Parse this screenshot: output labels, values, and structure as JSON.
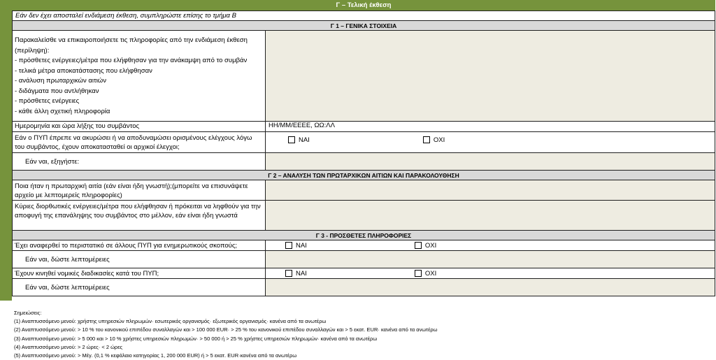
{
  "title": "Γ – Τελική έκθεση",
  "note_top": "Εάν δεν έχει αποσταλεί ενδιάμεση έκθεση, συμπληρώστε επίσης το τμήμα Β",
  "sections": {
    "g1": "Γ 1 – ΓΕΝΙΚΑ ΣΤΟΙΧΕΙΑ",
    "g2": "Γ 2 – ΑΝΑΛΥΣΗ ΤΩΝ ΠΡΩΤΑΡΧΙΚΩΝ ΑΙΤΙΩΝ ΚΑΙ ΠΑΡΑΚΟΛΟΥΘΗΣΗ",
    "g3": "Γ 3 - ΠΡΟΣΘΕΤΕΣ ΠΛΗΡΟΦΟΡΙΕΣ"
  },
  "g1": {
    "update_intro": "Παρακαλείσθε να επικαιροποιήσετε τις πληροφορίες από την ενδιάμεση έκθεση (περίληψη):",
    "update_items": [
      "- πρόσθετες ενέργειες/μέτρα που ελήφθησαν για την ανάκαμψη από το συμβάν",
      "- τελικά μέτρα αποκατάστασης που ελήφθησαν",
      "- ανάλυση πρωταρχικών αιτιών",
      "- διδάγματα που αντλήθηκαν",
      "- πρόσθετες ενέργειες",
      "- κάθε άλλη σχετική πληροφορία"
    ],
    "end_date_label": "Ημερομηνία και ώρα λήξης του συμβάντος",
    "end_date_value": "ΗΗ/ΜΜ/ΕΕΕΕ, ΩΩ:ΛΛ",
    "controls_label": "Εάν ο ΠΥΠ έπρεπε να ακυρώσει ή να αποδυναμώσει ορισμένους ελέγχους λόγω του συμβάντος, έχουν αποκατασταθεί οι αρχικοί έλεγχοι;",
    "yes": "ΝΑΙ",
    "no": "ΟΧΙ",
    "explain_label": "Εάν ναι, εξηγήστε:"
  },
  "g2": {
    "root_cause_label": "Ποια ήταν η πρωταρχική αιτία (εάν είναι ήδη γνωστή);(μπορείτε να επισυνάψετε αρχείο με λεπτομερείς πληροφορίες)",
    "corrective_label": "Κύριες διορθωτικές ενέργειες/μέτρα που ελήφθησαν ή πρόκειται να ληφθούν για την αποφυγή της επανάληψης του συμβάντος στο μέλλον, εάν είναι ήδη γνωστά"
  },
  "g3": {
    "reported_label": "Έχει αναφερθεί το περιστατικό σε άλλους ΠΥΠ για ενημερωτικούς σκοπούς;",
    "details_label": "Εάν ναι, δώστε λεπτομέρειες",
    "legal_label": "Έχουν κινηθεί νομικές διαδικασίες κατά του ΠΥΠ;",
    "details_label_2": "Εάν ναι, δώστε λεπτομέρειες",
    "yes": "ΝΑΙ",
    "no": "ΟΧΙ"
  },
  "footnotes": {
    "heading": "Σημειώσεις:",
    "items": [
      "(1) Αναπτυσσόμενο μενού: χρήστης υπηρεσιών πληρωμών· εσωτερικός οργανισμός· εξωτερικός οργανισμός· κανένα από τα ανωτέρω",
      "(2) Αναπτυσσόμενο μενού: > 10 % του κανονικού επιπέδου συναλλαγών και > 100 000 EUR· > 25 % του κανονικού επιπέδου συναλλαγών και > 5 εκατ. EUR· κανένα από τα ανωτέρω",
      "(3) Αναπτυσσόμενο μενού: > 5 000 και > 10 % χρήστες υπηρεσιών πληρωμών· > 50 000 ή > 25 % χρήστες υπηρεσιών πληρωμών· κανένα από τα ανωτέρω",
      "(4) Αναπτυσσόμενο μενού: > 2 ώρες· < 2 ώρες",
      "(5) Αναπτυσσόμενο μενού: > Μέγ. (0,1 % κεφάλαιο κατηγορίας 1, 200 000 EUR) ή > 5 εκατ. EUR·κανένα από τα ανωτέρω"
    ]
  }
}
